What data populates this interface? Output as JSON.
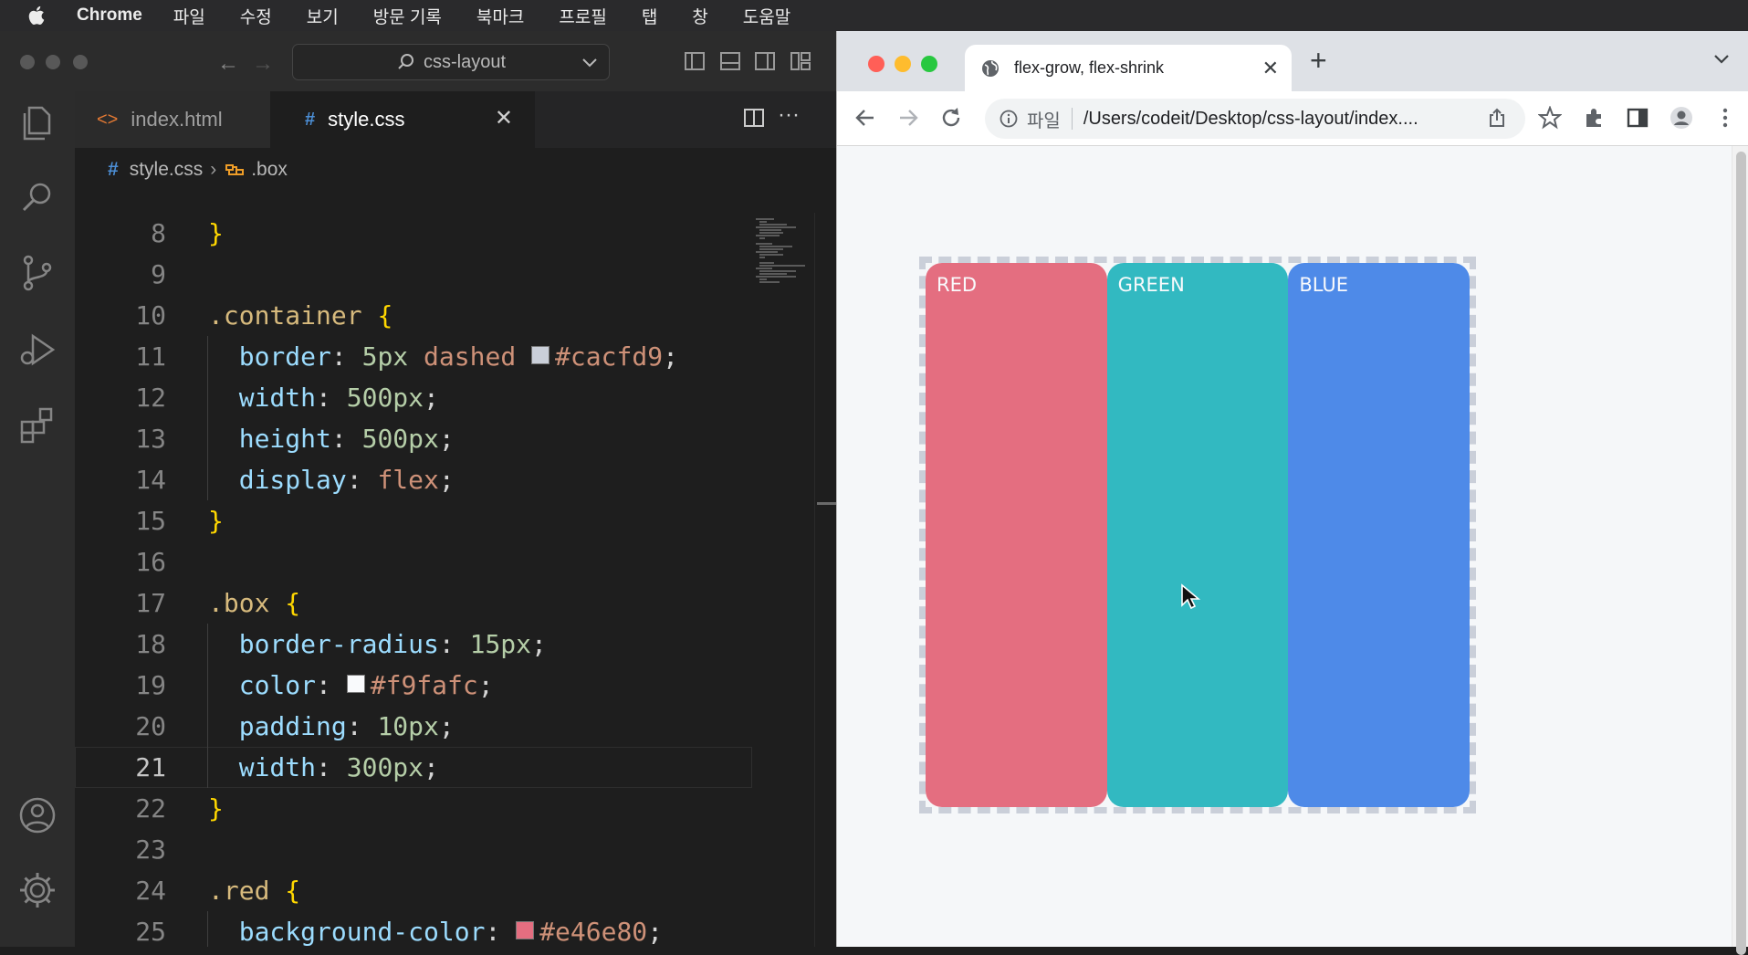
{
  "menubar": {
    "app_name": "Chrome",
    "items": [
      "파일",
      "수정",
      "보기",
      "방문 기록",
      "북마크",
      "프로필",
      "탭",
      "창",
      "도움말"
    ]
  },
  "vscode": {
    "search_text": "css-layout",
    "tabs": [
      {
        "icon": "<>",
        "label": "index.html",
        "active": false
      },
      {
        "icon": "#",
        "label": "style.css",
        "active": true
      }
    ],
    "breadcrumb": {
      "file": "style.css",
      "symbol": ".box"
    },
    "current_line": 21,
    "code_lines": [
      {
        "n": "8",
        "text": "}"
      },
      {
        "n": "9",
        "text": ""
      },
      {
        "n": "10",
        "text": ".container {"
      },
      {
        "n": "11",
        "text": "  border: 5px dashed #cacfd9;"
      },
      {
        "n": "12",
        "text": "  width: 500px;"
      },
      {
        "n": "13",
        "text": "  height: 500px;"
      },
      {
        "n": "14",
        "text": "  display: flex;"
      },
      {
        "n": "15",
        "text": "}"
      },
      {
        "n": "16",
        "text": ""
      },
      {
        "n": "17",
        "text": ".box {"
      },
      {
        "n": "18",
        "text": "  border-radius: 15px;"
      },
      {
        "n": "19",
        "text": "  color: #f9fafc;"
      },
      {
        "n": "20",
        "text": "  padding: 10px;"
      },
      {
        "n": "21",
        "text": "  width: 300px;"
      },
      {
        "n": "22",
        "text": "}"
      },
      {
        "n": "23",
        "text": ""
      },
      {
        "n": "24",
        "text": ".red {"
      },
      {
        "n": "25",
        "text": "  background-color: #e46e80;"
      }
    ],
    "colors": {
      "editor_bg": "#1e1e1e",
      "accent": "#4c8fd6"
    }
  },
  "chrome": {
    "tab_title": "flex-grow, flex-shrink",
    "omnibox": {
      "scheme": "파일",
      "url": "/Users/codeit/Desktop/css-layout/index...."
    },
    "boxes": [
      {
        "label": "RED",
        "color": "#e46e80"
      },
      {
        "label": "GREEN",
        "color": "#32b9c1"
      },
      {
        "label": "BLUE",
        "color": "#4e8ae8"
      }
    ],
    "container_border_color": "#cacfd9"
  }
}
